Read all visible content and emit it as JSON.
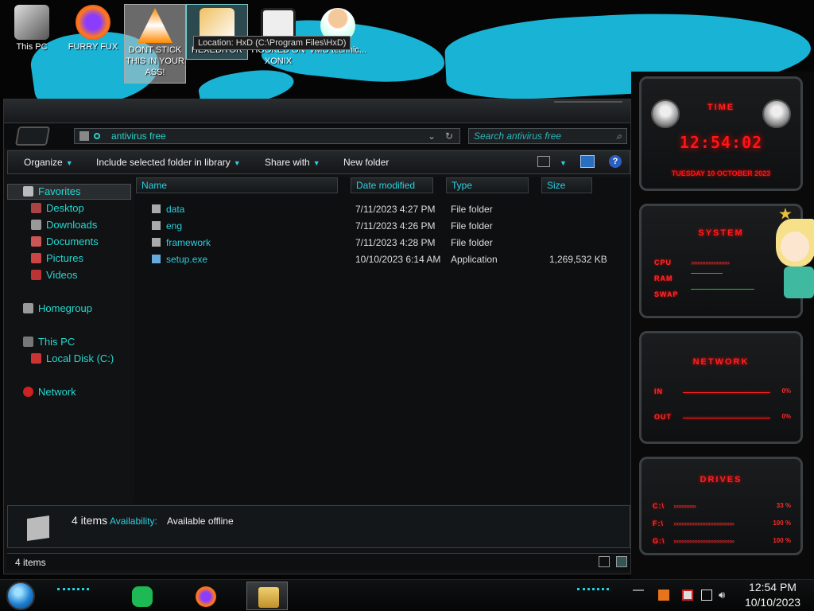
{
  "desktop": {
    "icons": [
      {
        "label": "This PC"
      },
      {
        "label": "FURRY FUX"
      },
      {
        "label": "DONT STICK THIS IN YOUR ASS!"
      },
      {
        "label": "HEXEDITOR"
      },
      {
        "label": "HOOKED ON XONIX"
      },
      {
        "label": "VMO technic..."
      }
    ],
    "tooltip": "Location: HxD (C:\\Program Files\\HxD)"
  },
  "explorer": {
    "address": "antivirus free",
    "search_placeholder": "Search antivirus free",
    "toolbar": {
      "organize": "Organize",
      "include": "Include selected folder in library",
      "share": "Share with",
      "new_folder": "New folder"
    },
    "nav": {
      "favorites": "Favorites",
      "desktop": "Desktop",
      "downloads": "Downloads",
      "documents": "Documents",
      "pictures": "Pictures",
      "videos": "Videos",
      "homegroup": "Homegroup",
      "this_pc": "This PC",
      "local_disk": "Local Disk (C:)",
      "network": "Network"
    },
    "columns": {
      "name": "Name",
      "date": "Date modified",
      "type": "Type",
      "size": "Size"
    },
    "files": [
      {
        "name": "data",
        "date": "7/11/2023 4:27 PM",
        "type": "File folder",
        "size": ""
      },
      {
        "name": "eng",
        "date": "7/11/2023 4:26 PM",
        "type": "File folder",
        "size": ""
      },
      {
        "name": "framework",
        "date": "7/11/2023 4:28 PM",
        "type": "File folder",
        "size": ""
      },
      {
        "name": "setup.exe",
        "date": "10/10/2023 6:14 AM",
        "type": "Application",
        "size": "1,269,532 KB"
      }
    ],
    "details": {
      "count": "4 items",
      "availability_label": "Availability:",
      "availability_value": "Available offline"
    },
    "status": "4 items"
  },
  "gadgets": {
    "time": {
      "title": "TIME",
      "clock": "12:54:02",
      "date": "TUESDAY 10 OCTOBER 2023"
    },
    "system": {
      "title": "SYSTEM",
      "cpu": "CPU",
      "ram": "RAM",
      "swap": "SWAP"
    },
    "network": {
      "title": "NETWORK",
      "in": "IN",
      "out": "OUT",
      "in_val": "0%",
      "out_val": "0%"
    },
    "drives": {
      "title": "DRIVES",
      "items": [
        {
          "label": "C:\\",
          "value": "33 %"
        },
        {
          "label": "F:\\",
          "value": "100 %"
        },
        {
          "label": "G:\\",
          "value": "100 %"
        }
      ]
    }
  },
  "taskbar": {
    "time": "12:54 PM",
    "date": "10/10/2023"
  },
  "colors": {
    "accent": "#2ad0e0",
    "gadget_red": "#ff1515",
    "wallpaper_blue": "#19b3d6"
  }
}
